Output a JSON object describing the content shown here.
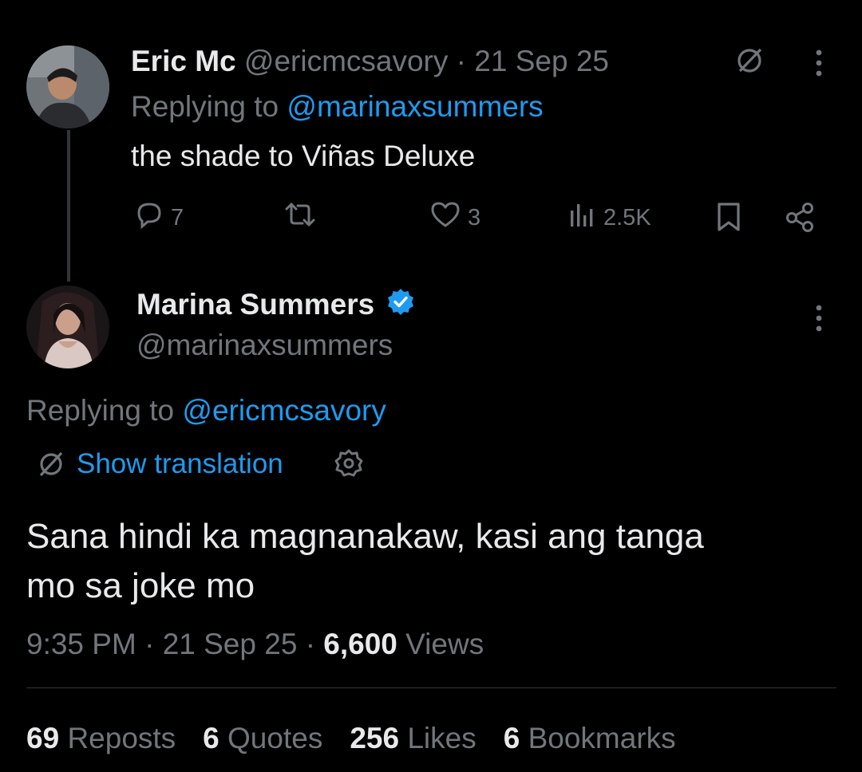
{
  "reply_tweet": {
    "author_name": "Eric Mc",
    "handle": "@ericmcsavory",
    "separator": "·",
    "date": "21 Sep 25",
    "replying_prefix": "Replying to ",
    "replying_handle": "@marinaxsummers",
    "text": "the shade to Viñas Deluxe",
    "actions": {
      "replies": "7",
      "reposts": "",
      "likes": "3",
      "views": "2.5K"
    }
  },
  "main_tweet": {
    "author_name": "Marina Summers",
    "handle": "@marinaxsummers",
    "verified": true,
    "replying_prefix": "Replying to ",
    "replying_handle": "@ericmcsavory",
    "translation_label": "Show translation",
    "text_line1": "Sana hindi ka magnanakaw, kasi ang tanga",
    "text_line2": "mo sa joke mo",
    "time": "9:35 PM",
    "separator": "·",
    "date": "21 Sep 25",
    "separator2": "·",
    "views_count": "6,600",
    "views_label": "Views"
  },
  "stats": [
    {
      "count": "69",
      "label": "Reposts"
    },
    {
      "count": "6",
      "label": "Quotes"
    },
    {
      "count": "256",
      "label": "Likes"
    },
    {
      "count": "6",
      "label": "Bookmarks"
    }
  ],
  "colors": {
    "background": "#000000",
    "text": "#e7e9ea",
    "muted": "#71767b",
    "accent": "#1d9bf0"
  },
  "icons": [
    "grok-icon",
    "more-icon",
    "reply-icon",
    "repost-icon",
    "like-icon",
    "views-icon",
    "bookmark-icon",
    "share-icon",
    "verified-badge-icon",
    "translate-icon",
    "settings-icon"
  ]
}
